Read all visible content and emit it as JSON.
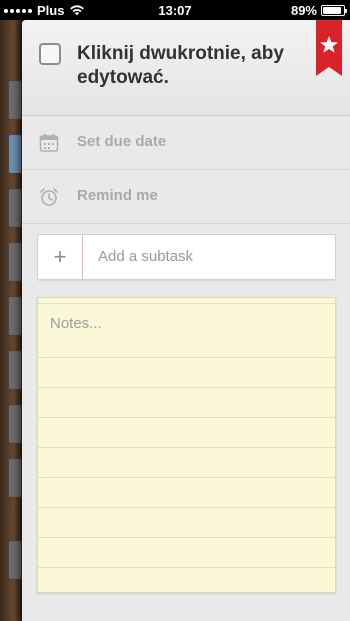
{
  "status_bar": {
    "carrier": "Plus",
    "time": "13:07",
    "battery": "89%",
    "battery_level": 0.89
  },
  "task": {
    "title": "Kliknij dwukrotnie, aby edytować.",
    "starred": true
  },
  "options": {
    "due_date_label": "Set due date",
    "remind_label": "Remind me"
  },
  "subtask": {
    "plus": "+",
    "placeholder": "Add a subtask"
  },
  "notes": {
    "placeholder": "Notes..."
  },
  "colors": {
    "ribbon": "#d8232a",
    "notes_paper": "#fbf8d8"
  },
  "icons": [
    "calendar-icon",
    "alarm-clock-icon",
    "star-icon",
    "wifi-icon",
    "battery-icon",
    "plus-icon"
  ]
}
